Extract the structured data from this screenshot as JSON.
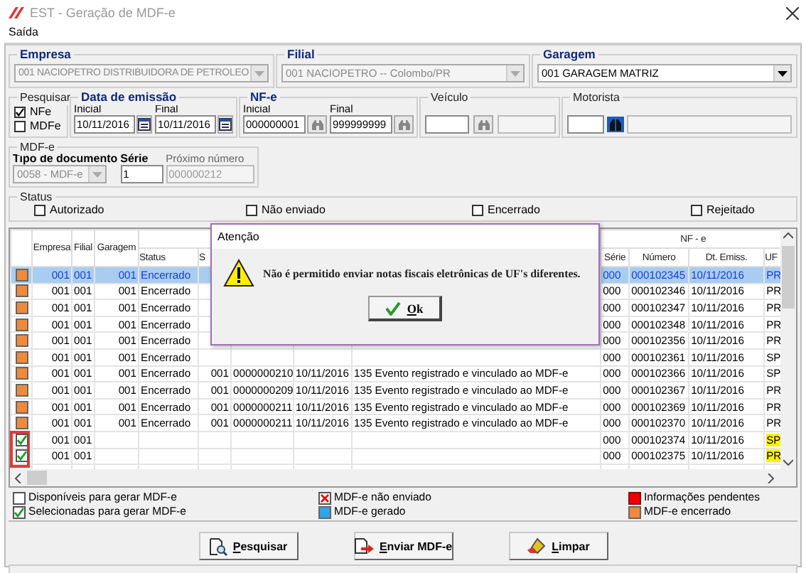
{
  "window": {
    "title": "EST - Geração de MDF-e"
  },
  "menu": [
    "Saída"
  ],
  "empresa": {
    "label": "Empresa",
    "value": "001 NACIOPETRO DISTRIBUIDORA DE PETROLEO",
    "disabled": true
  },
  "filial": {
    "label": "Filial",
    "value": "001 NACIOPETRO -- Colombo/PR",
    "disabled": true
  },
  "garagem": {
    "label": "Garagem",
    "value": "001 GARAGEM MATRIZ",
    "disabled": false
  },
  "pesquisar": {
    "label": "Pesquisar",
    "options": [
      {
        "label": "NFe",
        "checked": true
      },
      {
        "label": "MDFe",
        "checked": false
      }
    ]
  },
  "data_emissao": {
    "label": "Data de emissão",
    "inicial_label": "Inicial",
    "inicial": "10/11/2016",
    "final_label": "Final",
    "final": "10/11/2016"
  },
  "nfe": {
    "label": "NF-e",
    "inicial_label": "Inicial",
    "inicial": "000000001",
    "final_label": "Final",
    "final": "999999999"
  },
  "veiculo": {
    "label": "Veículo"
  },
  "motorista": {
    "label": "Motorista"
  },
  "mdfe": {
    "label": "MDF-e",
    "tipo_label": "Tipo de documento",
    "tipo": "0058 - MDF-e",
    "serie_label": "Série",
    "serie": "1",
    "proximo_label": "Próximo número",
    "proximo": "000000212"
  },
  "status": {
    "label": "Status",
    "options": [
      {
        "label": "Autorizado",
        "checked": false
      },
      {
        "label": "Não enviado",
        "checked": false
      },
      {
        "label": "Encerrado",
        "checked": false
      },
      {
        "label": "Rejeitado",
        "checked": false
      }
    ]
  },
  "grid": {
    "group_header": "NF - e",
    "columns": [
      "Empresa",
      "Filial",
      "Garagem",
      "Status",
      "S",
      null,
      null,
      null,
      "Série",
      "Número",
      "Dt. Emiss.",
      "UF"
    ],
    "rows": [
      {
        "kind": "encerrado",
        "selected": true,
        "flagged": false,
        "uf_highlight": false,
        "cells": [
          "001",
          "001",
          "001",
          "Encerrado",
          null,
          null,
          null,
          null,
          "000",
          "000102345",
          "10/11/2016",
          "PR"
        ]
      },
      {
        "kind": "encerrado",
        "selected": false,
        "flagged": false,
        "uf_highlight": false,
        "cells": [
          "001",
          "001",
          "001",
          "Encerrado",
          null,
          null,
          null,
          null,
          "000",
          "000102346",
          "10/11/2016",
          "PR"
        ]
      },
      {
        "kind": "encerrado",
        "selected": false,
        "flagged": false,
        "uf_highlight": false,
        "cells": [
          "001",
          "001",
          "001",
          "Encerrado",
          null,
          null,
          null,
          null,
          "000",
          "000102347",
          "10/11/2016",
          "PR"
        ]
      },
      {
        "kind": "encerrado",
        "selected": false,
        "flagged": false,
        "uf_highlight": false,
        "cells": [
          "001",
          "001",
          "001",
          "Encerrado",
          null,
          null,
          null,
          null,
          "000",
          "000102348",
          "10/11/2016",
          "PR"
        ]
      },
      {
        "kind": "encerrado",
        "selected": false,
        "flagged": false,
        "uf_highlight": false,
        "cells": [
          "001",
          "001",
          "001",
          "Encerrado",
          null,
          null,
          null,
          null,
          "000",
          "000102356",
          "10/11/2016",
          "PR"
        ]
      },
      {
        "kind": "encerrado",
        "selected": false,
        "flagged": false,
        "uf_highlight": false,
        "cells": [
          "001",
          "001",
          "001",
          "Encerrado",
          null,
          null,
          null,
          null,
          "000",
          "000102361",
          "10/11/2016",
          "SP"
        ]
      },
      {
        "kind": "encerrado",
        "selected": false,
        "flagged": false,
        "uf_highlight": false,
        "cells": [
          "001",
          "001",
          "001",
          "Encerrado",
          "001",
          "0000000210",
          "10/11/2016",
          "135 Evento registrado e vinculado ao MDF-e",
          "000",
          "000102366",
          "10/11/2016",
          "SP"
        ]
      },
      {
        "kind": "encerrado",
        "selected": false,
        "flagged": false,
        "uf_highlight": false,
        "cells": [
          "001",
          "001",
          "001",
          "Encerrado",
          "001",
          "0000000209",
          "10/11/2016",
          "135 Evento registrado e vinculado ao MDF-e",
          "000",
          "000102367",
          "10/11/2016",
          "PR"
        ]
      },
      {
        "kind": "encerrado",
        "selected": false,
        "flagged": false,
        "uf_highlight": false,
        "cells": [
          "001",
          "001",
          "001",
          "Encerrado",
          "001",
          "0000000211",
          "10/11/2016",
          "135 Evento registrado e vinculado ao MDF-e",
          "000",
          "000102369",
          "10/11/2016",
          "PR"
        ]
      },
      {
        "kind": "encerrado",
        "selected": false,
        "flagged": false,
        "uf_highlight": false,
        "cells": [
          "001",
          "001",
          "001",
          "Encerrado",
          "001",
          "0000000211",
          "10/11/2016",
          "135 Evento registrado e vinculado ao MDF-e",
          "000",
          "000102370",
          "10/11/2016",
          "PR"
        ]
      },
      {
        "kind": "selecionada",
        "selected": false,
        "flagged": true,
        "uf_highlight": true,
        "cells": [
          "001",
          "001",
          null,
          null,
          null,
          null,
          null,
          null,
          "000",
          "000102374",
          "10/11/2016",
          "SP"
        ]
      },
      {
        "kind": "selecionada",
        "selected": false,
        "flagged": true,
        "uf_highlight": true,
        "cells": [
          "001",
          "001",
          null,
          null,
          null,
          null,
          null,
          null,
          "000",
          "000102375",
          "10/11/2016",
          "PR"
        ]
      }
    ]
  },
  "legend": [
    {
      "kind": "box",
      "label": "Disponíveis para gerar MDF-e"
    },
    {
      "kind": "check",
      "label": "Selecionadas para gerar MDF-e"
    },
    {
      "kind": "cross",
      "label": "MDF-e não enviado"
    },
    {
      "kind": "gerado",
      "label": "MDF-e gerado"
    },
    {
      "kind": "pendente",
      "label": "Informações pendentes"
    },
    {
      "kind": "encerrado",
      "label": "MDF-e encerrado"
    }
  ],
  "buttons": [
    {
      "kind": "search",
      "label": "Pesquisar"
    },
    {
      "kind": "send",
      "label": "Enviar MDF-e"
    },
    {
      "kind": "clear",
      "label": "Limpar"
    }
  ],
  "dialog": {
    "title": "Atenção",
    "message": "Não é permitido enviar notas fiscais eletrônicas de UF's diferentes.",
    "button": "Ok"
  }
}
